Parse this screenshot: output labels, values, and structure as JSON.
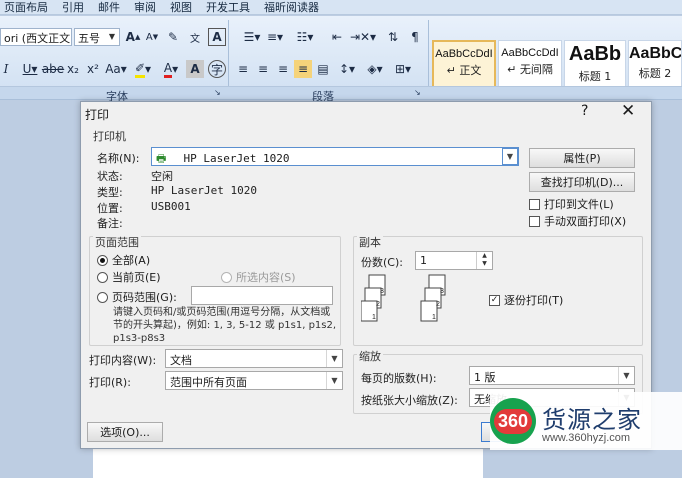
{
  "menu": [
    "页面布局",
    "引用",
    "邮件",
    "审阅",
    "视图",
    "开发工具",
    "福昕阅读器"
  ],
  "ribbon": {
    "font_name": "ori (西文正文 -",
    "font_size": "五号",
    "groups": {
      "font": "字体",
      "paragraph": "段落"
    },
    "styles": [
      {
        "sample": "AaBbCcDdI",
        "name": "↵ 正文"
      },
      {
        "sample": "AaBbCcDdI",
        "name": "↵ 无间隔"
      },
      {
        "sample": "AaBb",
        "name": "标题 1"
      },
      {
        "sample": "AaBbC",
        "name": "标题 2"
      }
    ],
    "accent_color": "#e6b85a"
  },
  "dialog": {
    "title": "打印",
    "help_glyph": "?",
    "close_glyph": "✕",
    "printer": {
      "section": "打印机",
      "name_label": "名称(N):",
      "name_value": "HP LaserJet 1020",
      "status_label": "状态:",
      "status_value": "空闲",
      "type_label": "类型:",
      "type_value": "HP LaserJet 1020",
      "where_label": "位置:",
      "where_value": "USB001",
      "comment_label": "备注:",
      "properties_button": "属性(P)",
      "find_button": "查找打印机(D)...",
      "print_to_file": "打印到文件(L)",
      "manual_duplex": "手动双面打印(X)"
    },
    "page_range": {
      "section": "页面范围",
      "all": "全部(A)",
      "current": "当前页(E)",
      "selection": "所选内容(S)",
      "pages": "页码范围(G):",
      "hint": "请键入页码和/或页码范围(用逗号分隔，从文档或节的开头算起)，例如: 1, 3, 5-12 或 p1s1, p1s2, p1s3-p8s3"
    },
    "copies": {
      "section": "副本",
      "count_label": "份数(C):",
      "count_value": "1",
      "collate": "逐份打印(T)"
    },
    "print_what_label": "打印内容(W):",
    "print_what_value": "文档",
    "print_label": "打印(R):",
    "print_value": "范围中所有页面",
    "zoom": {
      "section": "缩放",
      "pages_per_sheet_label": "每页的版数(H):",
      "pages_per_sheet_value": "1 版",
      "scale_label": "按纸张大小缩放(Z):",
      "scale_value": "无缩放"
    },
    "options_button": "选项(O)..."
  },
  "watermark": {
    "badge": "360",
    "name": "货源之家",
    "url": "www.360hyzj.com"
  }
}
